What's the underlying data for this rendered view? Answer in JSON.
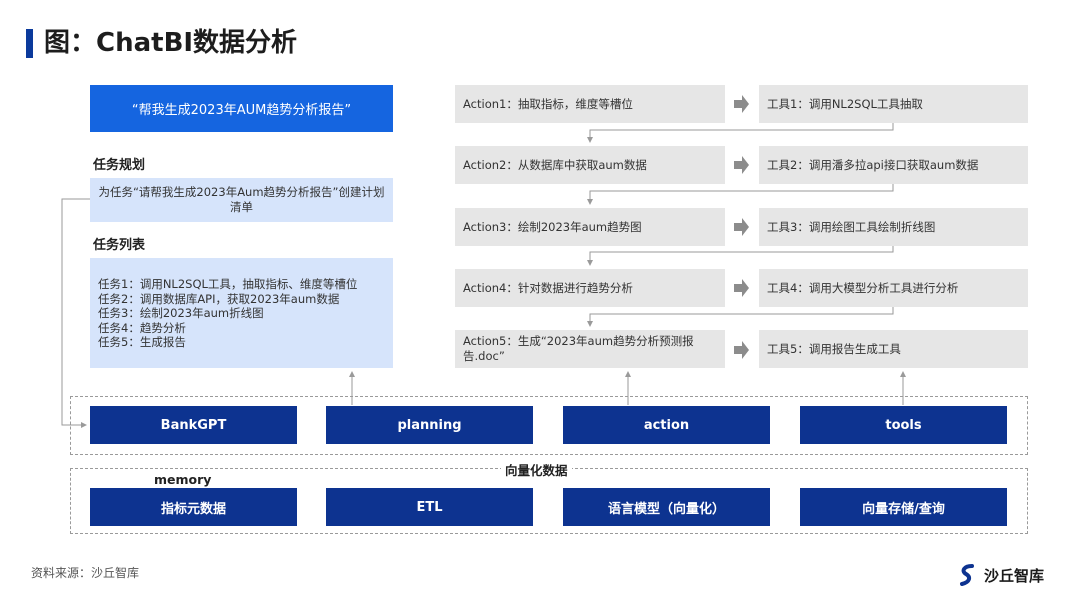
{
  "header": {
    "title": "图：ChatBI数据分析"
  },
  "left": {
    "prompt": "“帮我生成2023年AUM趋势分析报告”",
    "planning_label": "任务规划",
    "planning_text": "为任务“请帮我生成2023年Aum趋势分析报告”创建计划清单",
    "task_list_label": "任务列表",
    "tasks": [
      "任务1：调用NL2SQL工具，抽取指标、维度等槽位",
      "任务2：调用数据库API，获取2023年aum数据",
      "任务3：绘制2023年aum折线图",
      "任务4：趋势分析",
      "任务5：生成报告"
    ]
  },
  "actions": [
    "Action1：抽取指标，维度等槽位",
    "Action2：从数据库中获取aum数据",
    "Action3：绘制2023年aum趋势图",
    "Action4：针对数据进行趋势分析",
    "Action5：生成“2023年aum趋势分析预测报告.doc”"
  ],
  "tools": [
    "工具1：调用NL2SQL工具抽取",
    "工具2：调用潘多拉api接口获取aum数据",
    "工具3：调用绘图工具绘制折线图",
    "工具4：调用大模型分析工具进行分析",
    "工具5：调用报告生成工具"
  ],
  "agent_row": [
    "BankGPT",
    "planning",
    "action",
    "tools"
  ],
  "vector_label": "向量化数据",
  "memory_label": "memory",
  "memory_row": [
    "指标元数据",
    "ETL",
    "语言模型（向量化）",
    "向量存储/查询"
  ],
  "footer": {
    "source": "资料来源：沙丘智库",
    "brand": "沙丘智库"
  },
  "colors": {
    "accent_blue": "#1565e0",
    "dark_blue": "#0d3390",
    "light_blue": "#d6e4fb",
    "grey": "#e6e6e6"
  }
}
